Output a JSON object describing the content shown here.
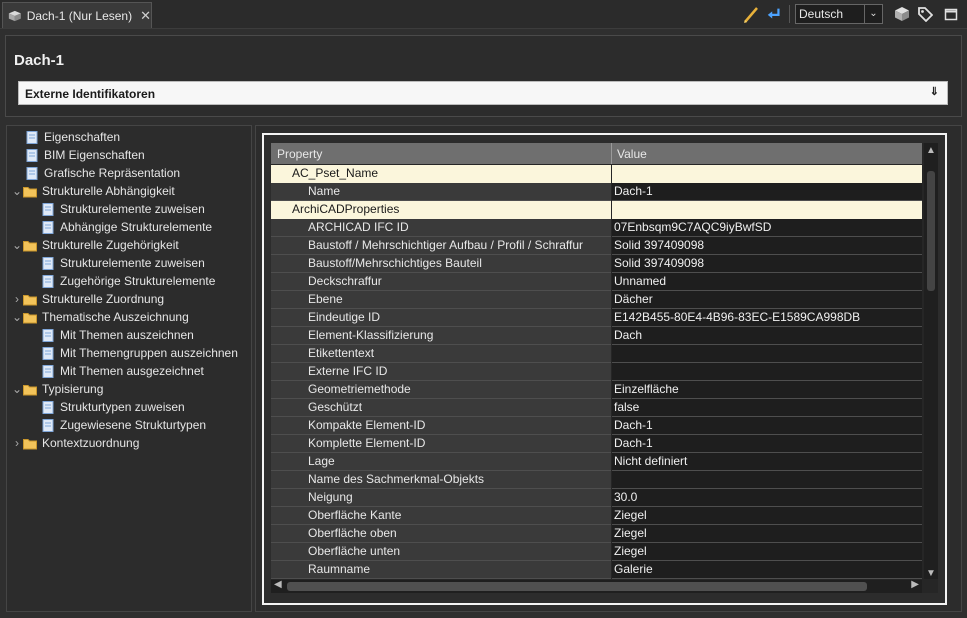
{
  "tab": {
    "label": "Dach-1 (Nur Lesen)",
    "close": "✕"
  },
  "toolbar": {
    "language": "Deutsch"
  },
  "header": {
    "title": "Dach-1",
    "section": "Externe Identifikatoren"
  },
  "tree": [
    {
      "label": "Eigenschaften",
      "level": 1,
      "folder": false,
      "twist": ""
    },
    {
      "label": "BIM Eigenschaften",
      "level": 1,
      "folder": false,
      "twist": ""
    },
    {
      "label": "Grafische Repräsentation",
      "level": 1,
      "folder": false,
      "twist": ""
    },
    {
      "label": "Strukturelle Abhängigkeit",
      "level": 0,
      "folder": true,
      "twist": "v"
    },
    {
      "label": "Strukturelemente zuweisen",
      "level": 2,
      "folder": false,
      "twist": ""
    },
    {
      "label": "Abhängige Strukturelemente",
      "level": 2,
      "folder": false,
      "twist": ""
    },
    {
      "label": "Strukturelle Zugehörigkeit",
      "level": 0,
      "folder": true,
      "twist": "v"
    },
    {
      "label": "Strukturelemente zuweisen",
      "level": 2,
      "folder": false,
      "twist": ""
    },
    {
      "label": "Zugehörige Strukturelemente",
      "level": 2,
      "folder": false,
      "twist": ""
    },
    {
      "label": "Strukturelle Zuordnung",
      "level": 0,
      "folder": true,
      "twist": ">"
    },
    {
      "label": "Thematische Auszeichnung",
      "level": 0,
      "folder": true,
      "twist": "v"
    },
    {
      "label": "Mit Themen auszeichnen",
      "level": 2,
      "folder": false,
      "twist": ""
    },
    {
      "label": "Mit Themengruppen auszeichnen",
      "level": 2,
      "folder": false,
      "twist": ""
    },
    {
      "label": "Mit Themen ausgezeichnet",
      "level": 2,
      "folder": false,
      "twist": ""
    },
    {
      "label": "Typisierung",
      "level": 0,
      "folder": true,
      "twist": "v"
    },
    {
      "label": "Strukturtypen zuweisen",
      "level": 2,
      "folder": false,
      "twist": ""
    },
    {
      "label": "Zugewiesene Strukturtypen",
      "level": 2,
      "folder": false,
      "twist": ""
    },
    {
      "label": "Kontextzuordnung",
      "level": 0,
      "folder": true,
      "twist": ">"
    }
  ],
  "grid": {
    "headers": [
      "Property",
      "Value"
    ],
    "rows": [
      {
        "type": "group",
        "name": "AC_Pset_Name",
        "value": ""
      },
      {
        "type": "prop",
        "name": "Name",
        "value": "Dach-1"
      },
      {
        "type": "group",
        "name": "ArchiCADProperties",
        "value": ""
      },
      {
        "type": "prop",
        "name": "ARCHICAD IFC ID",
        "value": "07Enbsqm9C7AQC9iyBwfSD"
      },
      {
        "type": "prop",
        "name": "Baustoff / Mehrschichtiger Aufbau / Profil / Schraffur",
        "value": "Solid 397409098"
      },
      {
        "type": "prop",
        "name": "Baustoff/Mehrschichtiges Bauteil",
        "value": "Solid 397409098"
      },
      {
        "type": "prop",
        "name": "Deckschraffur",
        "value": "Unnamed"
      },
      {
        "type": "prop",
        "name": "Ebene",
        "value": "Dächer"
      },
      {
        "type": "prop",
        "name": "Eindeutige ID",
        "value": "E142B455-80E4-4B96-83EC-E1589CA998DB"
      },
      {
        "type": "prop",
        "name": "Element-Klassifizierung",
        "value": "Dach"
      },
      {
        "type": "prop",
        "name": "Etikettentext",
        "value": ""
      },
      {
        "type": "prop",
        "name": "Externe IFC ID",
        "value": ""
      },
      {
        "type": "prop",
        "name": "Geometriemethode",
        "value": "Einzelfläche"
      },
      {
        "type": "prop",
        "name": "Geschützt",
        "value": "false"
      },
      {
        "type": "prop",
        "name": "Kompakte Element-ID",
        "value": "Dach-1"
      },
      {
        "type": "prop",
        "name": "Komplette Element-ID",
        "value": "Dach-1"
      },
      {
        "type": "prop",
        "name": "Lage",
        "value": "Nicht definiert"
      },
      {
        "type": "prop",
        "name": "Name des Sachmerkmal-Objekts",
        "value": ""
      },
      {
        "type": "prop",
        "name": "Neigung",
        "value": "30.0"
      },
      {
        "type": "prop",
        "name": "Oberfläche Kante",
        "value": "Ziegel"
      },
      {
        "type": "prop",
        "name": "Oberfläche oben",
        "value": "Ziegel"
      },
      {
        "type": "prop",
        "name": "Oberfläche unten",
        "value": "Ziegel"
      },
      {
        "type": "prop",
        "name": "Raumname",
        "value": "Galerie"
      }
    ]
  }
}
